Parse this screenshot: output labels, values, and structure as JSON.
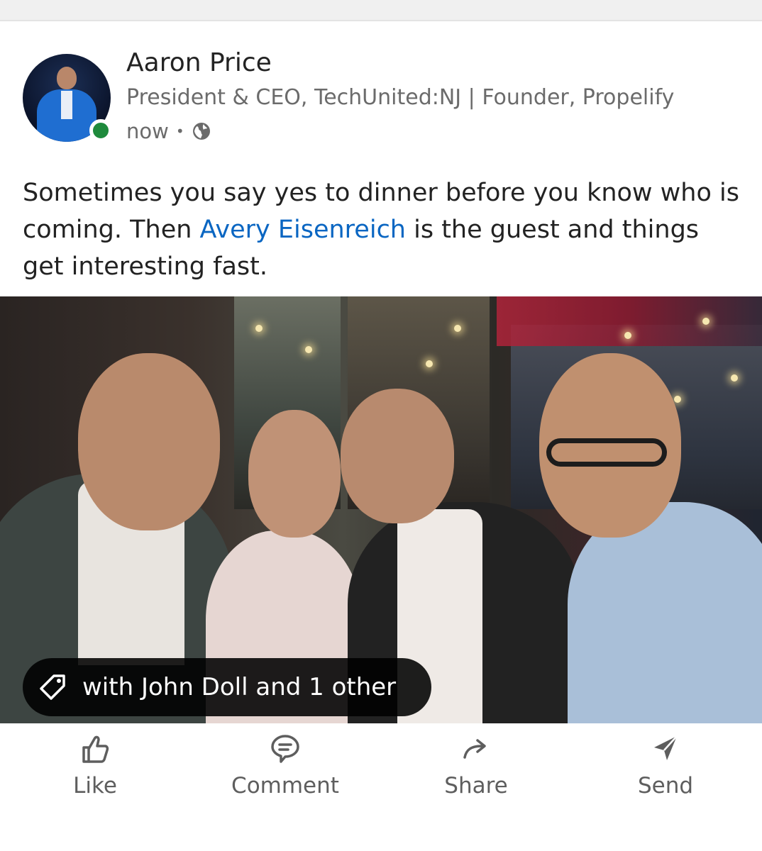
{
  "author": {
    "name": "Aaron Price",
    "headline": "President & CEO, TechUnited:NJ | Founder, Propelify",
    "time": "now",
    "separator": "•",
    "visibility_icon": "globe-icon",
    "online": true
  },
  "post": {
    "text_before": "Sometimes you say yes to dinner before you know who is coming. Then ",
    "mention": "Avery Eisenreich",
    "text_after": " is the guest and things get interesting fast."
  },
  "photo": {
    "tag_icon": "tag-icon",
    "tag_text": "with John Doll and 1 other"
  },
  "actions": [
    {
      "label": "Like",
      "icon": "thumbs-up-icon"
    },
    {
      "label": "Comment",
      "icon": "comment-icon"
    },
    {
      "label": "Share",
      "icon": "share-arrow-icon"
    },
    {
      "label": "Send",
      "icon": "send-icon"
    }
  ],
  "colors": {
    "mention": "#0a66c2",
    "online": "#1e8a3c",
    "muted": "#6b6b6b"
  }
}
